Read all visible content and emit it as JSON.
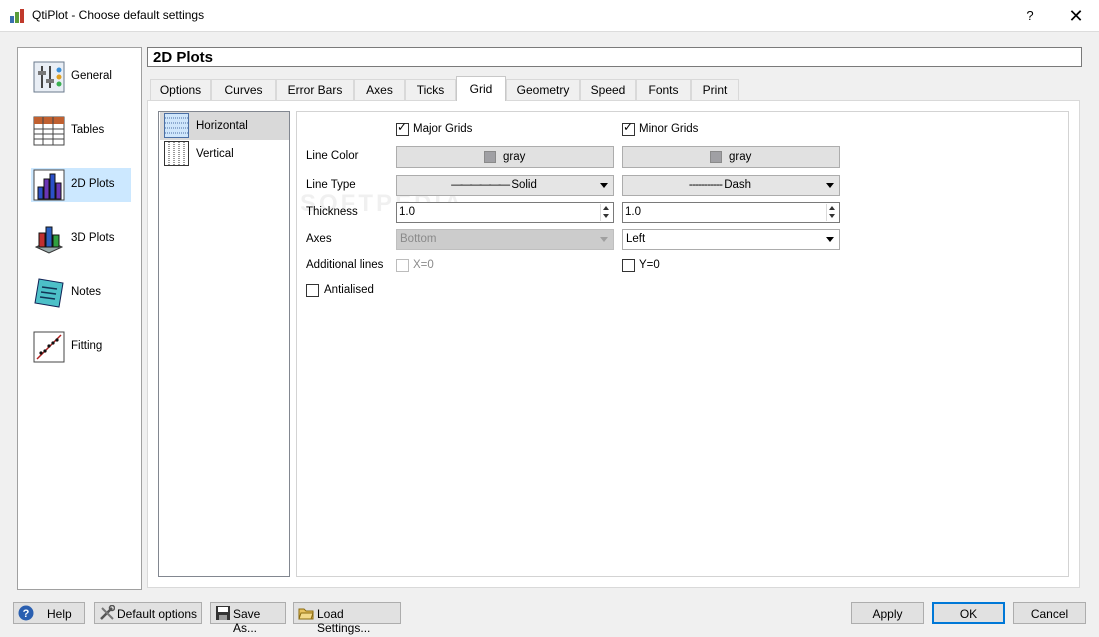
{
  "window": {
    "title": "QtiPlot - Choose default settings",
    "help_glyph": "?",
    "close_glyph": "✕",
    "app_icon": "qtiplot-icon"
  },
  "sidebar": {
    "items": [
      {
        "label": "General",
        "icon": "general-icon",
        "selected": false
      },
      {
        "label": "Tables",
        "icon": "tables-icon",
        "selected": false
      },
      {
        "label": "2D Plots",
        "icon": "2d-plots-icon",
        "selected": true
      },
      {
        "label": "3D Plots",
        "icon": "3d-plots-icon",
        "selected": false
      },
      {
        "label": "Notes",
        "icon": "notes-icon",
        "selected": false
      },
      {
        "label": "Fitting",
        "icon": "fitting-icon",
        "selected": false
      }
    ]
  },
  "page": {
    "title": "2D Plots"
  },
  "tabs": [
    "Options",
    "Curves",
    "Error Bars",
    "Axes",
    "Ticks",
    "Grid",
    "Geometry",
    "Speed",
    "Fonts",
    "Print"
  ],
  "active_tab": "Grid",
  "orientations": [
    {
      "label": "Horizontal",
      "icon": "horizontal-grid-icon",
      "selected": true
    },
    {
      "label": "Vertical",
      "icon": "vertical-grid-icon",
      "selected": false
    }
  ],
  "grid": {
    "major_label": "Major Grids",
    "major_checked": true,
    "minor_label": "Minor Grids",
    "minor_checked": true,
    "labels": {
      "line_color": "Line Color",
      "line_type": "Line Type",
      "thickness": "Thickness",
      "axes": "Axes",
      "additional_lines": "Additional lines",
      "antialised": "Antialised"
    },
    "major": {
      "color": "gray",
      "line_type": "Solid",
      "line_sample": "——————",
      "thickness": "1.0",
      "axis": "Bottom",
      "additional": "X=0"
    },
    "minor": {
      "color": "gray",
      "line_type": "Dash",
      "line_sample": "- - - - - - - - - - -",
      "thickness": "1.0",
      "axis": "Left",
      "additional": "Y=0"
    },
    "additional_major_checked": false,
    "additional_minor_checked": false,
    "antialised_checked": false
  },
  "footer": {
    "help": "Help",
    "default_options": "Default options",
    "save_as": "Save As...",
    "load_settings": "Load Settings...",
    "apply": "Apply",
    "ok": "OK",
    "cancel": "Cancel"
  },
  "watermark": "SOFTPEDIA",
  "colors": {
    "selection": "#cce8ff",
    "focus_border": "#0078d7",
    "swatch": "#a0a0a4"
  }
}
